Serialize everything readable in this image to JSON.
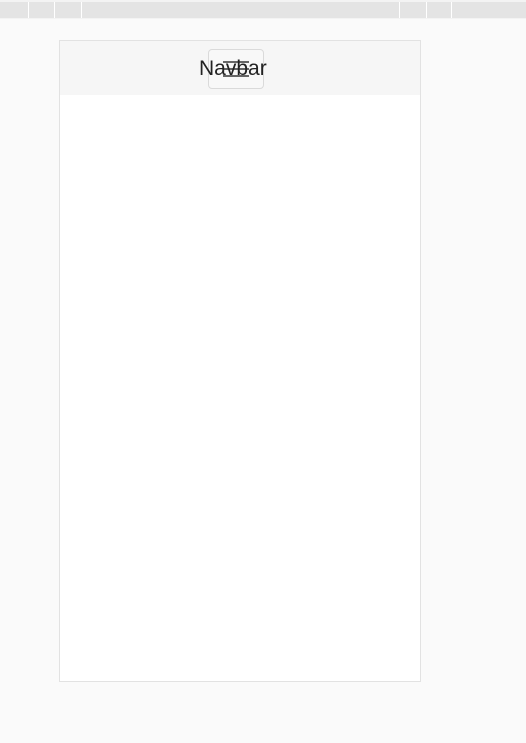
{
  "navbar": {
    "brand": "Navbar",
    "toggler_icon": "hamburger-menu-icon"
  },
  "colors": {
    "page_background": "#fafafa",
    "navbar_background": "#f6f6f6",
    "frame_border": "#e2e2e2",
    "brand_text": "#222222"
  }
}
